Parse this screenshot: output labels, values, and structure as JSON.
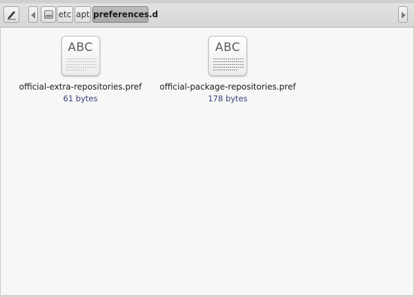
{
  "toolbar": {
    "edit_icon": "pencil-edit-icon",
    "breadcrumbs": [
      {
        "label": "",
        "icon": "drive-icon"
      },
      {
        "label": "etc"
      },
      {
        "label": "apt"
      },
      {
        "label": "preferences.d"
      }
    ]
  },
  "files": [
    {
      "name": "official-extra-repositories.pref",
      "size": "61 bytes",
      "icon_text": "ABC",
      "icon": "text-document-icon"
    },
    {
      "name": "official-package-repositories.pref",
      "size": "178 bytes",
      "icon_text": "ABC",
      "icon": "text-document-icon"
    }
  ],
  "colors": {
    "size_text": "#3a3f78",
    "active_crumb": "#b3b3b3",
    "background": "#f7f7f7"
  }
}
